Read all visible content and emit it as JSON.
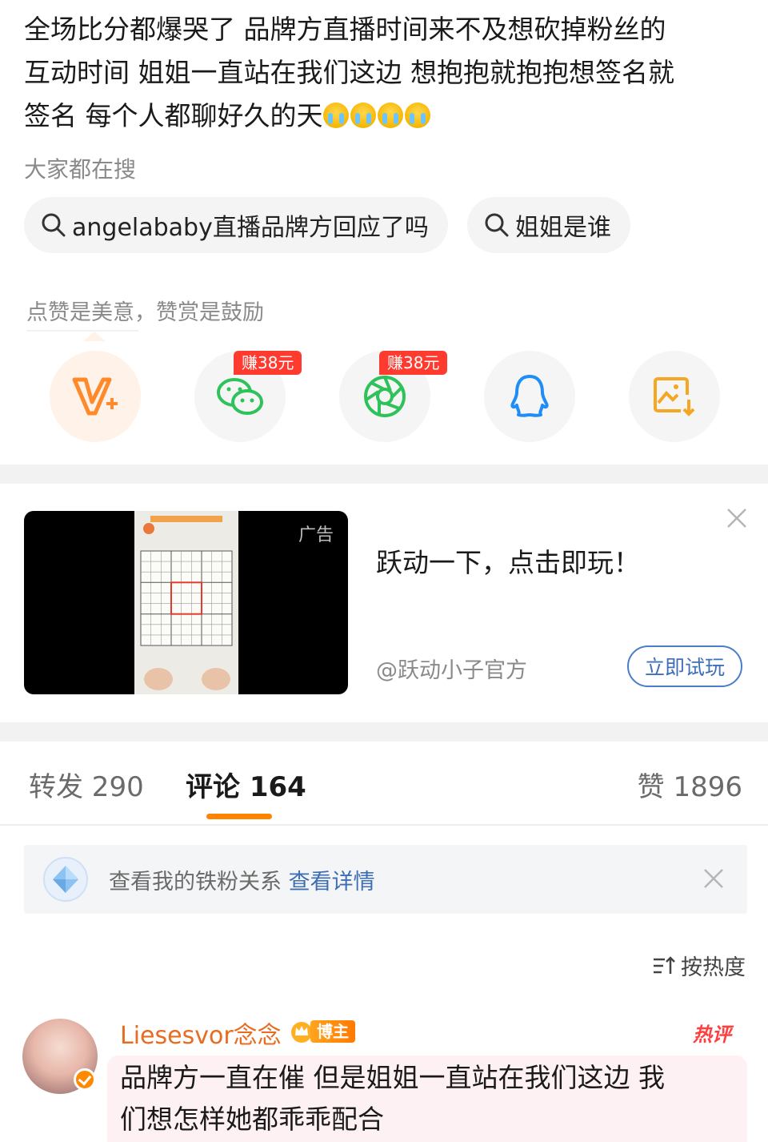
{
  "post": {
    "line1": "全场比分都爆哭了 品牌方直播时间来不及想砍掉粉丝的",
    "line2": "互动时间 姐姐一直站在我们这边 想抱抱就抱抱想签名就",
    "line3": "签名 每个人都聊好久的天",
    "emoji_count": 4,
    "emoji_name": "crying-face-icon"
  },
  "search": {
    "title": "大家都在搜",
    "chips": [
      "angelababy直播品牌方回应了吗",
      "姐姐是谁"
    ]
  },
  "share": {
    "hint": "点赞是美意，赞赏是鼓励",
    "buttons": [
      {
        "name": "reward-icon",
        "badge": ""
      },
      {
        "name": "wechat-icon",
        "badge": "赚38元"
      },
      {
        "name": "moments-icon",
        "badge": "赚38元"
      },
      {
        "name": "qq-icon",
        "badge": ""
      },
      {
        "name": "save-image-icon",
        "badge": ""
      }
    ]
  },
  "ad": {
    "label": "广告",
    "title": "跃动一下，点击即玩！",
    "source": "@跃动小子官方",
    "cta": "立即试玩"
  },
  "tabs": {
    "repost": "转发 290",
    "comments": "评论 164",
    "likes": "赞 1896"
  },
  "fan_bar": {
    "text": "查看我的铁粉关系",
    "link": "查看详情"
  },
  "sort": {
    "label": "按热度"
  },
  "comment": {
    "username": "Liesesvor念念",
    "badge": "博主",
    "hot_label": "热评",
    "line1": "品牌方一直在催 但是姐姐一直站在我们这边 我",
    "line2": "们想怎样她都乖乖配合"
  },
  "colors": {
    "accent_orange": "#ff8200",
    "link_blue": "#3d6eb4",
    "badge_red": "#ff3b30",
    "wechat_green": "#2fc25b",
    "qq_blue": "#1f8df5",
    "save_orange": "#f5a623"
  }
}
